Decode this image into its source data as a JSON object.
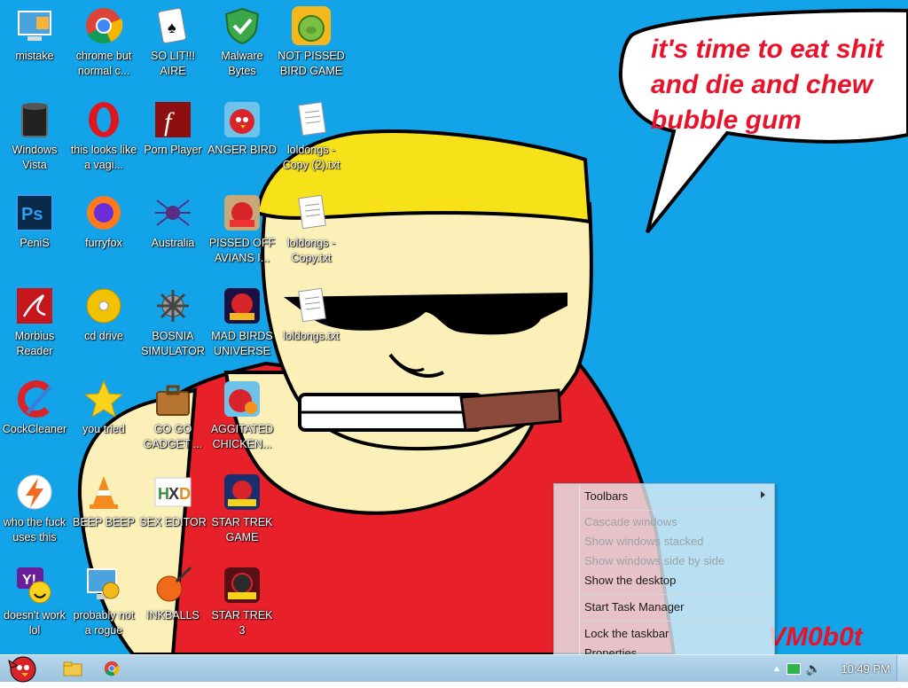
{
  "speech": {
    "lines": [
      "it's time to eat shit",
      "and die and chew",
      "bubble gum"
    ]
  },
  "signature": "VM0b0t",
  "icons": [
    {
      "label": "mistake",
      "icon": "computer-icon"
    },
    {
      "label": "chrome but normal c...",
      "icon": "chrome-icon"
    },
    {
      "label": "SO LIT!!! AIRE",
      "icon": "solitaire-icon"
    },
    {
      "label": "Malware Bytes",
      "icon": "shield-icon"
    },
    {
      "label": "NOT PISSED BIRD GAME",
      "icon": "green-pig-icon"
    },
    {
      "label": "Windows Vista",
      "icon": "trash-bin-icon"
    },
    {
      "label": "this looks like a vagi...",
      "icon": "opera-icon"
    },
    {
      "label": "Porn Player",
      "icon": "flash-icon"
    },
    {
      "label": "ANGER BIRD",
      "icon": "angry-bird-icon"
    },
    {
      "label": "loldongs - Copy (2).txt",
      "icon": "text-file-icon"
    },
    {
      "label": "PeniS",
      "icon": "photoshop-icon"
    },
    {
      "label": "furryfox",
      "icon": "firefox-icon"
    },
    {
      "label": "Australia",
      "icon": "spider-solitaire-icon"
    },
    {
      "label": "PISSED OFF AVIANS I...",
      "icon": "angry-birds-seasons-icon"
    },
    {
      "label": "loldongs - Copy.txt",
      "icon": "text-file-icon"
    },
    {
      "label": "Morbius Reader",
      "icon": "pdf-reader-icon"
    },
    {
      "label": "cd drive",
      "icon": "cd-icon"
    },
    {
      "label": "BOSNIA SIMULATOR",
      "icon": "mine-icon"
    },
    {
      "label": "MAD BIRDS UNIVERSE",
      "icon": "angry-birds-space-icon"
    },
    {
      "label": "loldongs.txt",
      "icon": "text-file-icon"
    },
    {
      "label": "CockCleaner",
      "icon": "ccleaner-icon"
    },
    {
      "label": "you tried",
      "icon": "star-icon"
    },
    {
      "label": "GO GO GADGET ...",
      "icon": "briefcase-icon"
    },
    {
      "label": "AGGITATED CHICKEN...",
      "icon": "angry-bird-chicken-icon"
    },
    {
      "label": "who the fuck uses this",
      "icon": "lightning-icon"
    },
    {
      "label": "BEEP BEEP",
      "icon": "vlc-cone-icon"
    },
    {
      "label": "SEX EDITOR",
      "icon": "hxd-icon"
    },
    {
      "label": "STAR TREK GAME",
      "icon": "angry-birds-star-wars-icon"
    },
    {
      "label": "doesn't work lol",
      "icon": "yahoo-messenger-icon"
    },
    {
      "label": "probably not a rogue",
      "icon": "settings-monitor-icon"
    },
    {
      "label": "INKBALLS",
      "icon": "inkball-icon"
    },
    {
      "label": "STAR TREK 3",
      "icon": "angry-birds-star-wars-2-icon"
    }
  ],
  "context_menu": {
    "toolbars": "Toolbars",
    "cascade": "Cascade windows",
    "stacked": "Show windows stacked",
    "side_by_side": "Show windows side by side",
    "show_desktop": "Show the desktop",
    "task_manager": "Start Task Manager",
    "lock": "Lock the taskbar",
    "properties": "Properties"
  },
  "taskbar": {
    "clock": "10:49 PM",
    "apps": [
      "explorer-icon",
      "chrome-icon"
    ]
  },
  "colors": {
    "desktop": "#13a3e8",
    "speech_text": "#e8132a",
    "shirt": "#e8202a",
    "hair": "#f7e21a",
    "skin": "#fbf0b8"
  }
}
